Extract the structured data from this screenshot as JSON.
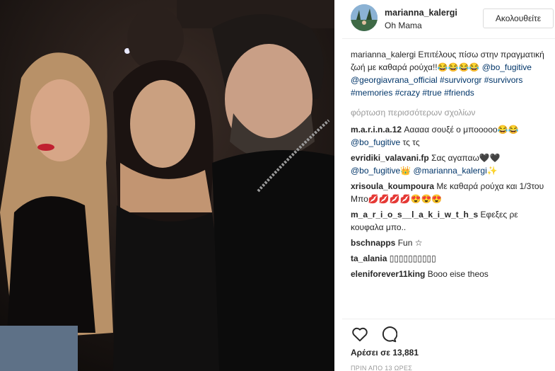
{
  "header": {
    "username": "marianna_kalergi",
    "location": "Oh Mama",
    "follow_label": "Ακολουθείτε"
  },
  "caption": {
    "username": "marianna_kalergi",
    "text": "Επιτέλους πίσω στην πραγματική ζωή με καθαρά ρούχα!!😂😂😂😂",
    "mentions": [
      "@bo_fugitive",
      "@georgiavrana_official"
    ],
    "hashtags": [
      "#survivorgr",
      "#survivors",
      "#memories",
      "#crazy",
      "#true",
      "#friends"
    ]
  },
  "load_more_label": "φόρτωση περισσότερων σχολίων",
  "comments": [
    {
      "username": "m.a.r.i.n.a.12",
      "text": "Ααααα σουξέ ο μποοοοο😂😂",
      "mention": "@bo_fugitive",
      "after": " τς τς"
    },
    {
      "username": "evridiki_valavani.fp",
      "text": "Σας αγαπαω🖤🖤",
      "mention": "@bo_fugitive",
      "mid": "👑",
      "mention2": "@marianna_kalergi",
      "after": "✨"
    },
    {
      "username": "xrisoula_koumpoura",
      "text": "Με καθαρά ρούχα και 1/3του Μπο💋💋💋💋😍😍😍"
    },
    {
      "username": "m_a_r_i_o_s__l_a_k_i_w_t_h_s",
      "text": "Εφεξες ρε κουφαλα μπο.."
    },
    {
      "username": "bschnapps",
      "text": "Fun ☆"
    },
    {
      "username": "ta_alania",
      "text": "▯▯▯▯▯▯▯▯▯▯"
    },
    {
      "username": "eleniforever11king",
      "text": "Booo eise theos"
    }
  ],
  "likes_label": "Αρέσει σε 13,881",
  "time_label": "ΠΡΙΝ ΑΠΟ 13 ΩΡΕΣ",
  "icons": {
    "like": "heart-outline-icon",
    "comment": "speech-bubble-icon"
  }
}
